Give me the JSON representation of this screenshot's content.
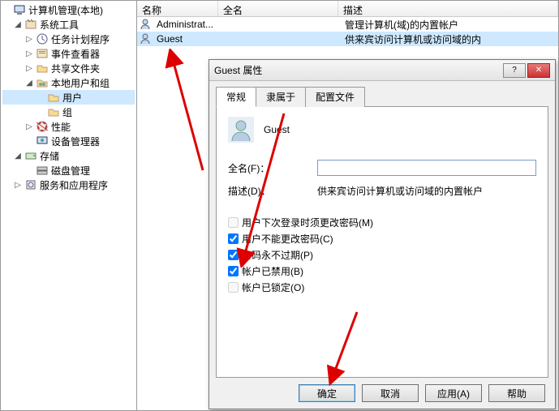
{
  "tree": {
    "root": "计算机管理(本地)",
    "sys_tools": "系统工具",
    "task_scheduler": "任务计划程序",
    "event_viewer": "事件查看器",
    "shared_folders": "共享文件夹",
    "local_users_groups": "本地用户和组",
    "users": "用户",
    "groups": "组",
    "performance": "性能",
    "device_manager": "设备管理器",
    "storage": "存储",
    "disk_management": "磁盘管理",
    "services_apps": "服务和应用程序"
  },
  "columns": {
    "name": "名称",
    "fullname": "全名",
    "description": "描述"
  },
  "users_list": [
    {
      "name": "Administrat...",
      "fullname": "",
      "description": "管理计算机(域)的内置帐户"
    },
    {
      "name": "Guest",
      "fullname": "",
      "description": "供来宾访问计算机或访问域的内"
    }
  ],
  "dialog": {
    "title": "Guest 属性",
    "tabs": {
      "general": "常规",
      "member_of": "隶属于",
      "profile": "配置文件"
    },
    "username": "Guest",
    "fullname_label": "全名(F)：",
    "fullname_value": "",
    "description_label": "描述(D)：",
    "description_value": "供来宾访问计算机或访问域的内置帐户",
    "chk_must_change": "用户下次登录时须更改密码(M)",
    "chk_cannot_change": "用户不能更改密码(C)",
    "chk_never_expire": "密码永不过期(P)",
    "chk_disabled": "帐户已禁用(B)",
    "chk_locked": "帐户已锁定(O)",
    "btn_ok": "确定",
    "btn_cancel": "取消",
    "btn_apply": "应用(A)",
    "btn_help": "帮助"
  }
}
